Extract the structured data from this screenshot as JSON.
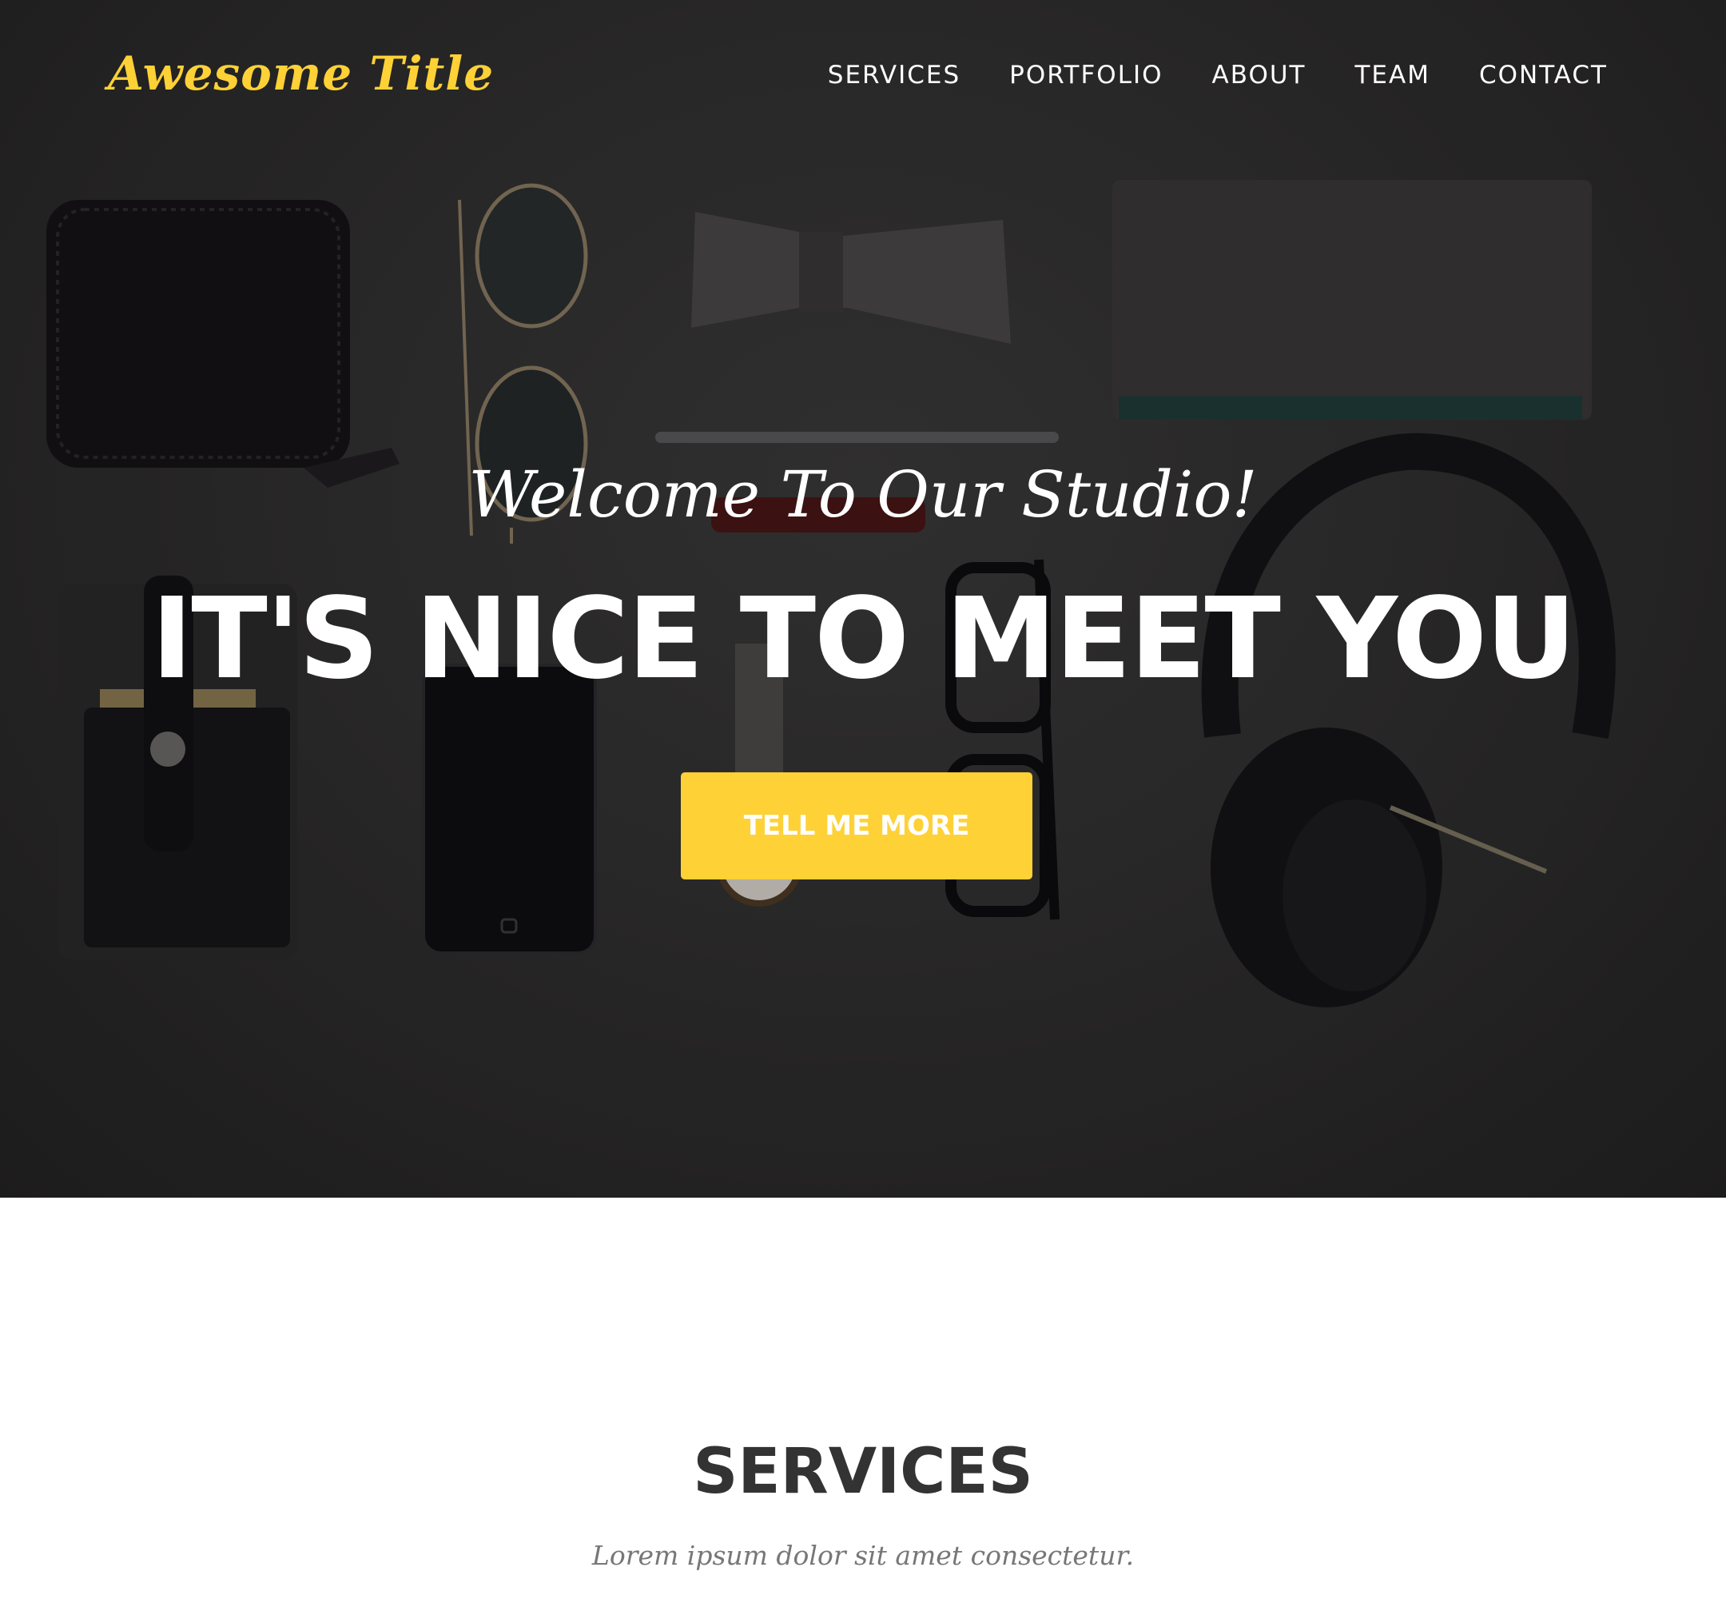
{
  "brand": "Awesome Title",
  "nav": {
    "items": [
      "SERVICES",
      "PORTFOLIO",
      "ABOUT",
      "TEAM",
      "CONTACT"
    ]
  },
  "hero": {
    "lead": "Welcome To Our Studio!",
    "heading": "IT'S NICE TO MEET YOU",
    "cta": "TELL ME MORE"
  },
  "services": {
    "heading": "SERVICES",
    "subheading": "Lorem ipsum dolor sit amet consectetur."
  },
  "colors": {
    "accent": "#fed136",
    "hero_bg": "#2f2e2e",
    "heading_dark": "#333333",
    "muted": "#777777"
  },
  "icons": [
    "wallet-icon",
    "sunglasses-icon",
    "bowtie-icon",
    "notebook-icon",
    "pen-icon",
    "phone-icon",
    "watch-icon",
    "glasses-icon",
    "headphones-icon",
    "card-holder-icon"
  ]
}
